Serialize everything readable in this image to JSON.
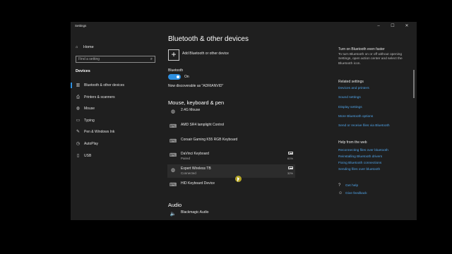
{
  "window": {
    "title": "Settings",
    "minimize": "–",
    "maximize": "☐",
    "close": "✕"
  },
  "sidebar": {
    "home": "Home",
    "search_placeholder": "Find a setting",
    "section": "Devices",
    "items": [
      {
        "label": "Bluetooth & other devices",
        "icon": "bluetooth-devices-icon",
        "glyph": "▥"
      },
      {
        "label": "Printers & scanners",
        "icon": "printer-icon",
        "glyph": "⎙"
      },
      {
        "label": "Mouse",
        "icon": "mouse-icon",
        "glyph": "◍"
      },
      {
        "label": "Typing",
        "icon": "keyboard-icon",
        "glyph": "▭"
      },
      {
        "label": "Pen & Windows Ink",
        "icon": "pen-icon",
        "glyph": "✎"
      },
      {
        "label": "AutoPlay",
        "icon": "autoplay-icon",
        "glyph": "◷"
      },
      {
        "label": "USB",
        "icon": "usb-icon",
        "glyph": "▯"
      }
    ]
  },
  "main": {
    "title": "Bluetooth & other devices",
    "add_label": "Add Bluetooth or other device",
    "bluetooth_label": "Bluetooth",
    "toggle_state": "On",
    "discoverable": "Now discoverable as \"ADRIANVID\"",
    "mouse_section": "Mouse, keyboard & pen",
    "devices": [
      {
        "name": "2.4G Mouse",
        "status": "",
        "battery": "",
        "icon": "mouse-icon",
        "glyph": "◍"
      },
      {
        "name": "AMD SR4 lamplight Control",
        "status": "",
        "battery": "",
        "icon": "keyboard-icon",
        "glyph": "⌨"
      },
      {
        "name": "Corsair Gaming K55 RGB Keyboard",
        "status": "",
        "battery": "",
        "icon": "keyboard-icon",
        "glyph": "⌨"
      },
      {
        "name": "DaVinci Keyboard",
        "status": "Paired",
        "battery": "61%",
        "icon": "keyboard-icon",
        "glyph": "⌨"
      },
      {
        "name": "Expert Wireless TB",
        "status": "Connected",
        "battery": "32%",
        "icon": "mouse-icon",
        "glyph": "◍"
      },
      {
        "name": "HID Keyboard Device",
        "status": "",
        "battery": "",
        "icon": "keyboard-icon",
        "glyph": "⌨"
      }
    ],
    "audio_section": "Audio",
    "audio_devices": [
      {
        "name": "Blackmagic Audio",
        "icon": "speaker-icon",
        "glyph": "🔈"
      }
    ]
  },
  "right": {
    "faster_title": "Turn on Bluetooth even faster",
    "faster_text": "To turn Bluetooth on or off without opening Settings, open action center and select the Bluetooth icon.",
    "related_title": "Related settings",
    "related_links": [
      "Devices and printers",
      "Sound settings",
      "Display settings",
      "More Bluetooth options",
      "Send or receive files via Bluetooth"
    ],
    "help_title": "Help from the web",
    "help_links": [
      "Reconnecting files over bluetooth",
      "Reinstalling Bluetooth drivers",
      "Fixing Bluetooth connections",
      "Sending files over bluetooth"
    ],
    "get_help": "Get help",
    "give_feedback": "Give feedback"
  },
  "colors": {
    "accent": "#2d8fe0",
    "link": "#4fa3e8",
    "background": "#1f1f1f"
  }
}
